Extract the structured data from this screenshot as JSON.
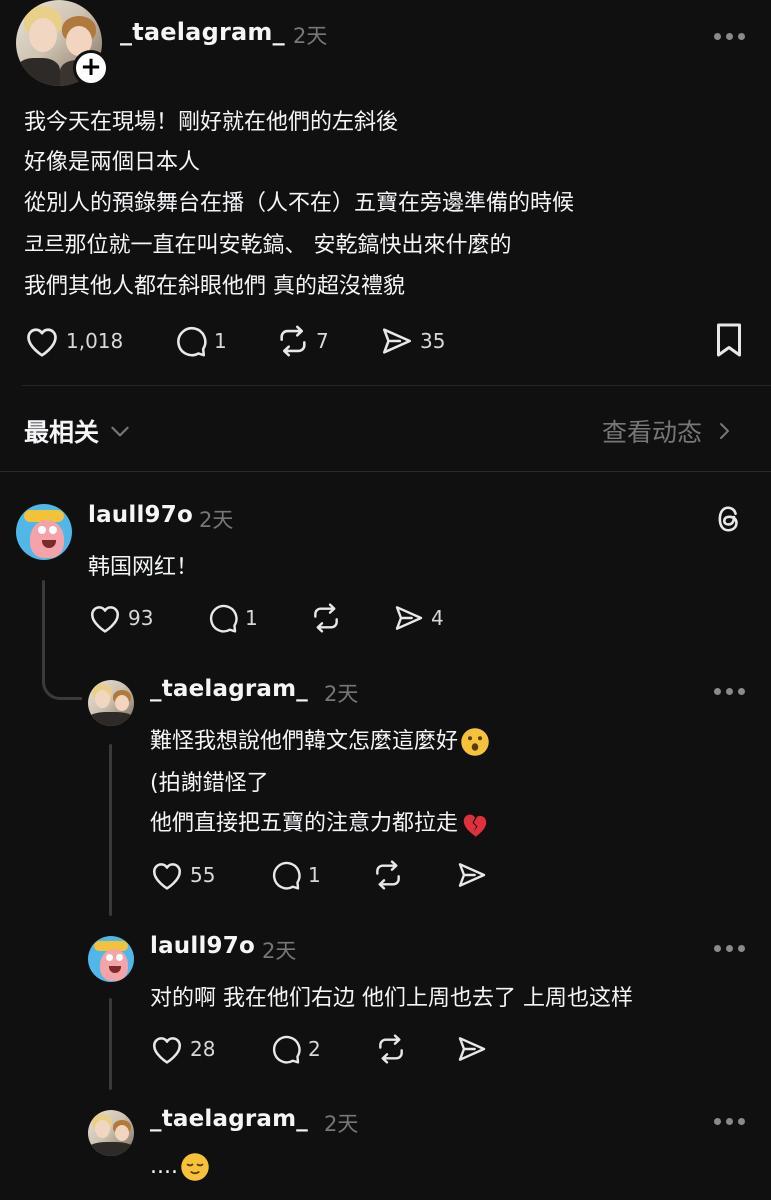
{
  "post": {
    "username": "_taelagram_",
    "time": "2天",
    "lines": [
      "我今天在現場！剛好就在他們的左斜後",
      "好像是兩個日本人",
      "從別人的預錄舞台在播（人不在）五寶在旁邊準備的時候",
      "코르那位就一直在叫安乾鎬、 安乾鎬快出來什麼的",
      "我們其他人都在斜眼他們 真的超沒禮貌"
    ],
    "likes": "1,018",
    "comments": "1",
    "reposts": "7",
    "shares": "35"
  },
  "sort": {
    "label": "最相关",
    "view_activity": "查看动态"
  },
  "replies": [
    {
      "username": "laull97o",
      "time": "2天",
      "text": "韩国网红！",
      "likes": "93",
      "comments": "1",
      "reposts": "",
      "shares": "4"
    },
    {
      "username": "_taelagram_",
      "time": "2天",
      "lines": [
        "難怪我想說他們韓文怎麼這麼好",
        "(拍謝錯怪了",
        "他們直接把五寶的注意力都拉走"
      ],
      "likes": "55",
      "comments": "1"
    },
    {
      "username": "laull97o",
      "time": "2天",
      "text": "对的啊 我在他们右边 他们上周也去了 上周也这样",
      "likes": "28",
      "comments": "2"
    },
    {
      "username": "_taelagram_",
      "time": "2天",
      "text": "...."
    }
  ],
  "colors": {
    "background": "#101010",
    "text": "#f3f5f7",
    "muted": "#777777"
  },
  "icons": [
    "plus-icon",
    "more-icon",
    "heart-icon",
    "comment-icon",
    "repost-icon",
    "share-icon",
    "bookmark-icon",
    "chevron-down-icon",
    "chevron-right-icon",
    "threads-logo-icon",
    "hushed-face-emoji",
    "broken-heart-emoji",
    "relieved-face-emoji"
  ]
}
